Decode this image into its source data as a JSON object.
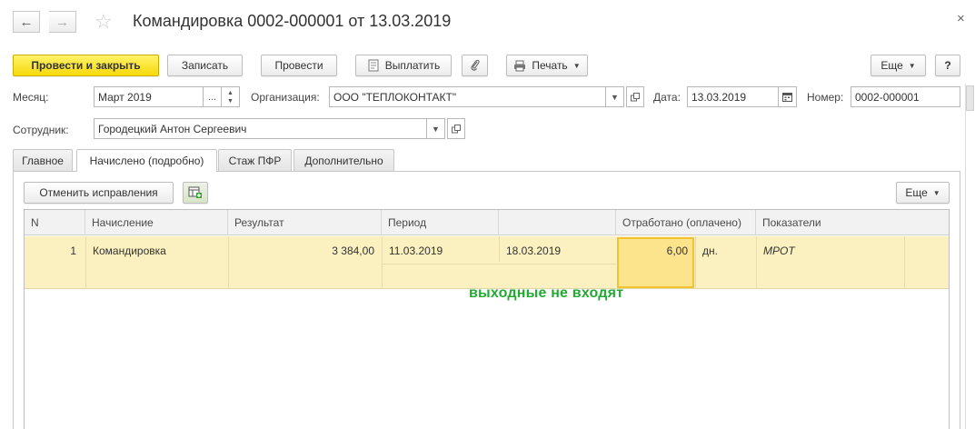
{
  "window": {
    "title": "Командировка 0002-000001 от 13.03.2019",
    "close_glyph": "×"
  },
  "toolbar": {
    "post_close": "Провести и закрыть",
    "save": "Записать",
    "post": "Провести",
    "pay": "Выплатить",
    "print": "Печать",
    "more": "Еще",
    "help": "?"
  },
  "form": {
    "month_label": "Месяц:",
    "month_value": "Март 2019",
    "org_label": "Организация:",
    "org_value": "ООО \"ТЕПЛОКОНТАКТ\"",
    "date_label": "Дата:",
    "date_value": "13.03.2019",
    "number_label": "Номер:",
    "number_value": "0002-000001",
    "employee_label": "Сотрудник:",
    "employee_value": "Городецкий Антон Сергеевич"
  },
  "tabs": [
    {
      "label": "Главное"
    },
    {
      "label": "Начислено (подробно)"
    },
    {
      "label": "Стаж ПФР"
    },
    {
      "label": "Дополнительно"
    }
  ],
  "panel": {
    "cancel_corrections": "Отменить исправления",
    "more": "Еще"
  },
  "table": {
    "headers": [
      "N",
      "Начисление",
      "Результат",
      "Период",
      "",
      "Отработано (оплачено)",
      "Показатели"
    ],
    "rows": [
      {
        "n": "1",
        "accrual": "Командировка",
        "result": "3 384,00",
        "period_from": "11.03.2019",
        "period_to": "18.03.2019",
        "worked": "6,00",
        "unit": "дн.",
        "indicator": "МРОТ"
      }
    ]
  },
  "annotation": "выходные не входят",
  "colors": {
    "primary_button": "#f7d90a",
    "row_highlight": "#fbf0c0",
    "selected_cell": "#fbe48c",
    "annotation": "#22aa33"
  }
}
